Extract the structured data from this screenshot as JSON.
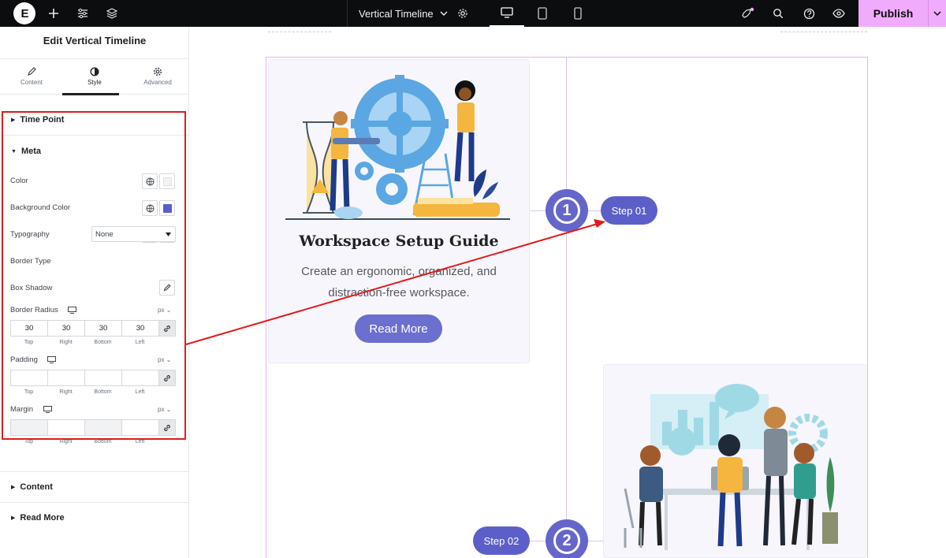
{
  "topbar": {
    "logo": "E",
    "document_title": "Vertical Timeline",
    "publish_label": "Publish"
  },
  "panel": {
    "title": "Edit Vertical Timeline",
    "tabs": [
      {
        "label": "Content",
        "icon": "pencil-icon"
      },
      {
        "label": "Style",
        "icon": "contrast-icon"
      },
      {
        "label": "Advanced",
        "icon": "gear-icon"
      }
    ],
    "sections": {
      "time_point": "Time Point",
      "meta": "Meta",
      "content": "Content",
      "read_more": "Read More"
    },
    "meta": {
      "color_label": "Color",
      "color_value": "#ffffff",
      "background_color_label": "Background Color",
      "background_color_value": "#5b5fc7",
      "typography_label": "Typography",
      "border_type_label": "Border Type",
      "border_type_value": "None",
      "box_shadow_label": "Box Shadow",
      "border_radius_label": "Border Radius",
      "border_radius_unit": "px",
      "border_radius_values": [
        "30",
        "30",
        "30",
        "30"
      ],
      "padding_label": "Padding",
      "padding_unit": "px",
      "margin_label": "Margin",
      "margin_unit": "px",
      "dim_labels": [
        "Top",
        "Right",
        "Bottom",
        "Left"
      ]
    }
  },
  "canvas": {
    "card1": {
      "title": "Workspace Setup Guide",
      "text": "Create an ergonomic, organized, and distraction-free workspace.",
      "button": "Read More"
    },
    "step1": {
      "number": "1",
      "label": "Step 01"
    },
    "step2": {
      "number": "2",
      "label": "Step 02"
    }
  },
  "colors": {
    "accent_pink": "#f0abfc",
    "highlight_red": "#e01b1b",
    "timeline_purple": "#6566c9"
  }
}
